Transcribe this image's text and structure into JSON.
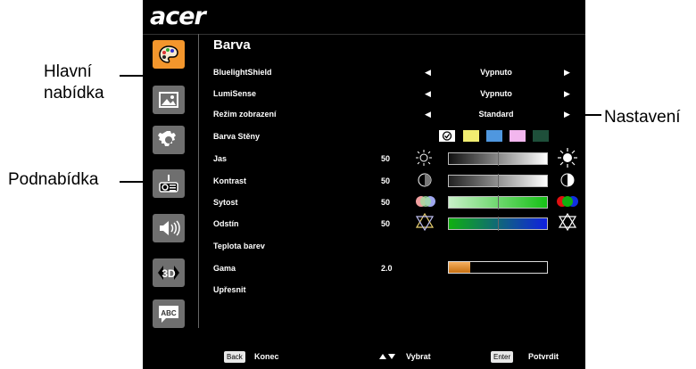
{
  "callouts": {
    "main_menu_line1": "Hlavní",
    "main_menu_line2": "nabídka",
    "submenu": "Podnabídka",
    "settings": "Nastavení"
  },
  "osd": {
    "logo": "acer",
    "sidebar_icons": [
      "palette-icon",
      "picture-icon",
      "gear-icon",
      "clock-icon",
      "speaker-icon",
      "3d-icon",
      "abc-language-icon"
    ],
    "active_index": 0,
    "sidebar_item_labels": {
      "3d": "3D",
      "abc": "ABC"
    },
    "title": "Barva",
    "rows": {
      "blueshield": {
        "label": "BluelightShield",
        "value": "Vypnuto"
      },
      "lumisense": {
        "label": "LumiSense",
        "value": "Vypnuto"
      },
      "display_mode": {
        "label": "Režim zobrazení",
        "value": "Standard"
      },
      "wall_color": {
        "label": "Barva Stěny"
      },
      "brightness": {
        "label": "Jas",
        "value": "50",
        "fraction": 0.5
      },
      "contrast": {
        "label": "Kontrast",
        "value": "50",
        "fraction": 0.5
      },
      "saturation": {
        "label": "Sytost",
        "value": "50",
        "fraction": 0.5
      },
      "hue": {
        "label": "Odstín",
        "value": "50",
        "fraction": 0.5
      },
      "color_temp": {
        "label": "Teplota barev"
      },
      "gamma": {
        "label": "Gama",
        "value": "2.0",
        "fraction": 0.22
      },
      "advanced": {
        "label": "Upřesnit"
      }
    },
    "wall_colors": [
      "#f1ed71",
      "#4f97df",
      "#f2b6ee",
      "#1e4f3a"
    ],
    "footer": {
      "back_key": "Back",
      "back_label": "Konec",
      "select_label": "Vybrat",
      "enter_key": "Enter",
      "enter_label": "Potvrdit"
    }
  },
  "colors": {
    "accent": "#f3962c",
    "osd_bg": "#000000"
  }
}
